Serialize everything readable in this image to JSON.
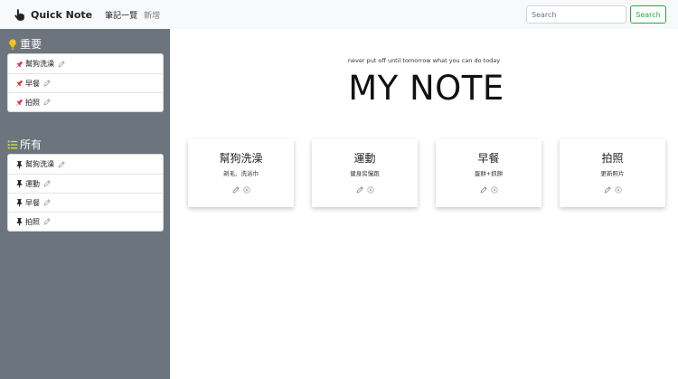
{
  "navbar": {
    "brand_icon": "hand-pointer-icon",
    "brand": "Quick Note",
    "links": [
      "筆記一覽",
      "新增"
    ],
    "search_placeholder": "Search",
    "search_button": "Search"
  },
  "sidebar": {
    "important": {
      "title": "重要",
      "icon": "lightbulb-icon",
      "items": [
        {
          "label": "幫狗洗澡"
        },
        {
          "label": "早餐"
        },
        {
          "label": "拍照"
        }
      ]
    },
    "all": {
      "title": "所有",
      "icon": "list-icon",
      "items": [
        {
          "label": "幫狗洗澡"
        },
        {
          "label": "運動"
        },
        {
          "label": "早餐"
        },
        {
          "label": "拍照"
        }
      ]
    }
  },
  "main": {
    "quote": "never put off until tomorrow what you can do today",
    "title": "MY NOTE",
    "cards": [
      {
        "title": "幫狗洗澡",
        "text": "剃毛、洗浴巾"
      },
      {
        "title": "運動",
        "text": "健身房慢跑"
      },
      {
        "title": "早餐",
        "text": "蛋餅+抓餅"
      },
      {
        "title": "拍照",
        "text": "更新照片"
      }
    ]
  },
  "colors": {
    "sidebar_bg": "#6c757d",
    "navbar_bg": "#f8f9fa",
    "pin_important": "#dc3545",
    "pin_normal": "#212529",
    "search_accent": "#28a745",
    "lightbulb": "#f0c419",
    "list_icon": "#c6e43a"
  }
}
